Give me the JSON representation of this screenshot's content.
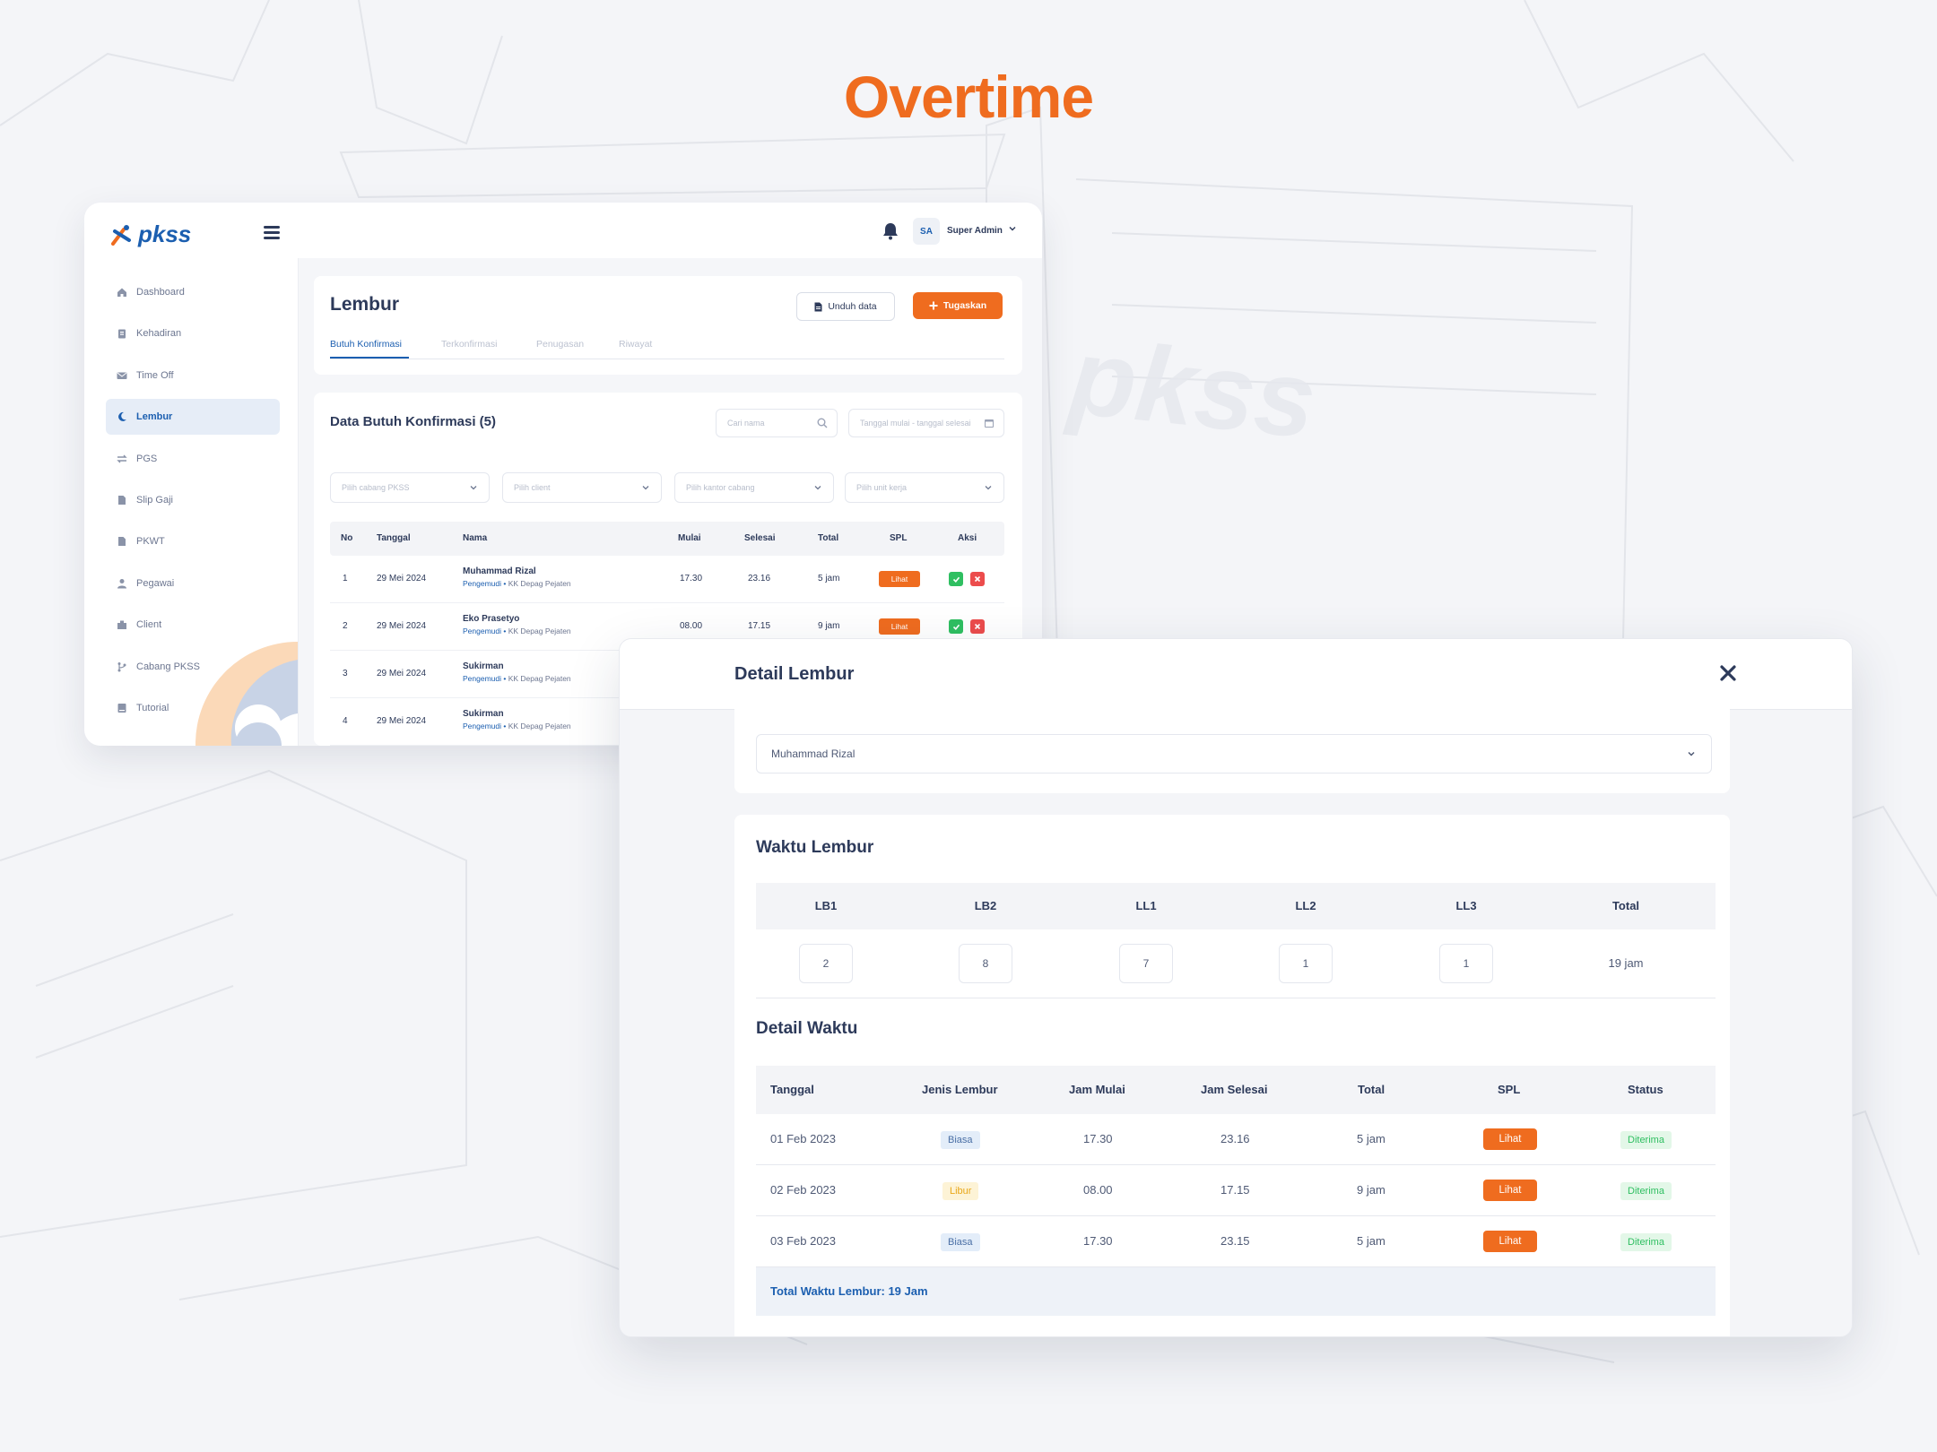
{
  "hero": {
    "title": "Overtime"
  },
  "brand": {
    "logo_text": "pkss",
    "accent": "#ef6c1f",
    "primary": "#1c5fb0"
  },
  "sidebar": {
    "items": [
      {
        "label": "Dashboard",
        "icon": "home-icon"
      },
      {
        "label": "Kehadiran",
        "icon": "clipboard-icon"
      },
      {
        "label": "Time Off",
        "icon": "mail-icon"
      },
      {
        "label": "Lembur",
        "icon": "moon-icon",
        "active": true
      },
      {
        "label": "PGS",
        "icon": "swap-icon"
      },
      {
        "label": "Slip Gaji",
        "icon": "document-icon"
      },
      {
        "label": "PKWT",
        "icon": "document-icon"
      },
      {
        "label": "Pegawai",
        "icon": "user-icon"
      },
      {
        "label": "Client",
        "icon": "building-icon"
      },
      {
        "label": "Cabang PKSS",
        "icon": "branch-icon"
      },
      {
        "label": "Tutorial",
        "icon": "book-icon"
      }
    ]
  },
  "topbar": {
    "avatar_initials": "SA",
    "user_name": "Super Admin"
  },
  "page": {
    "title": "Lembur",
    "download_label": "Unduh data",
    "assign_label": "Tugaskan",
    "tabs": [
      "Butuh Konfirmasi",
      "Terkonfirmasi",
      "Penugasan",
      "Riwayat"
    ]
  },
  "data_card": {
    "title": "Data Butuh Konfirmasi (5)",
    "search_placeholder": "Cari nama",
    "date_placeholder": "Tanggal mulai - tanggal selesai",
    "filters": [
      "Pilih cabang PKSS",
      "Pilih client",
      "Pilih kantor cabang",
      "Pilih unit kerja"
    ],
    "columns": [
      "No",
      "Tanggal",
      "Nama",
      "Mulai",
      "Selesai",
      "Total",
      "SPL",
      "Aksi"
    ],
    "rows": [
      {
        "no": "1",
        "tanggal": "29 Mei 2024",
        "nama": "Muhammad Rizal",
        "role": "Pengemudi",
        "unit": "KK Depag Pejaten",
        "mulai": "17.30",
        "selesai": "23.16",
        "total": "5 jam",
        "spl": "Lihat"
      },
      {
        "no": "2",
        "tanggal": "29 Mei 2024",
        "nama": "Eko Prasetyo",
        "role": "Pengemudi",
        "unit": "KK Depag Pejaten",
        "mulai": "08.00",
        "selesai": "17.15",
        "total": "9 jam",
        "spl": "Lihat"
      },
      {
        "no": "3",
        "tanggal": "29 Mei 2024",
        "nama": "Sukirman",
        "role": "Pengemudi",
        "unit": "KK Depag Pejaten"
      },
      {
        "no": "4",
        "tanggal": "29 Mei 2024",
        "nama": "Sukirman",
        "role": "Pengemudi",
        "unit": "KK Depag Pejaten"
      }
    ]
  },
  "modal": {
    "title": "Detail Lembur",
    "employee_selected": "Muhammad Rizal",
    "waktu_title": "Waktu Lembur",
    "waktu_columns": [
      "LB1",
      "LB2",
      "LL1",
      "LL2",
      "LL3",
      "Total"
    ],
    "waktu_values": [
      "2",
      "8",
      "7",
      "1",
      "1"
    ],
    "waktu_total": "19 jam",
    "detail_title": "Detail Waktu",
    "detail_columns": [
      "Tanggal",
      "Jenis Lembur",
      "Jam Mulai",
      "Jam Selesai",
      "Total",
      "SPL",
      "Status"
    ],
    "detail_rows": [
      {
        "tanggal": "01 Feb 2023",
        "jenis": "Biasa",
        "mulai": "17.30",
        "selesai": "23.16",
        "total": "5 jam",
        "spl": "Lihat",
        "status": "Diterima"
      },
      {
        "tanggal": "02 Feb 2023",
        "jenis": "Libur",
        "mulai": "08.00",
        "selesai": "17.15",
        "total": "9 jam",
        "spl": "Lihat",
        "status": "Diterima"
      },
      {
        "tanggal": "03 Feb 2023",
        "jenis": "Biasa",
        "mulai": "17.30",
        "selesai": "23.15",
        "total": "5 jam",
        "spl": "Lihat",
        "status": "Diterima"
      }
    ],
    "total_text": "Total Waktu Lembur: 19 Jam"
  }
}
